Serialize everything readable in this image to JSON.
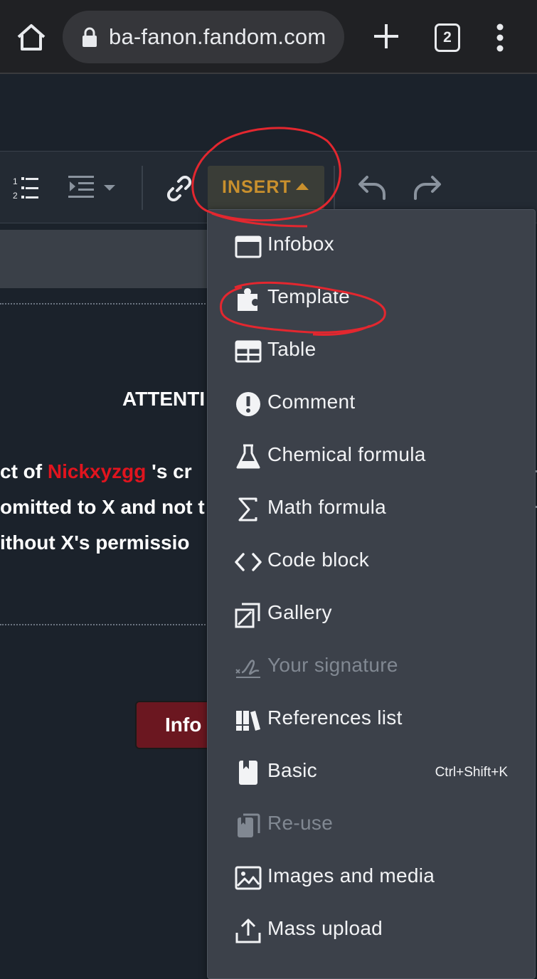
{
  "browser": {
    "url": "ba-fanon.fandom.com",
    "tab_count": "2",
    "icons": [
      "home-icon",
      "lock-icon",
      "plus-icon",
      "tab-switcher-icon",
      "overflow-menu-icon"
    ]
  },
  "toolbar": {
    "insert_label": "INSERT",
    "icons": [
      "numbered-list-icon",
      "indent-icon",
      "link-icon",
      "undo-icon",
      "redo-icon"
    ]
  },
  "content": {
    "heading": "ATTENTI",
    "line1_before": "ct of ",
    "line1_user": "Nickxyzgg",
    "line1_after": " 's cr",
    "line2": "omitted to X and not t",
    "line3": "ithout X's permissio",
    "info_button": "Info"
  },
  "insert_menu": {
    "items": [
      {
        "label": "Infobox",
        "icon": "infobox-icon",
        "disabled": false,
        "shortcut": ""
      },
      {
        "label": "Template",
        "icon": "puzzle-piece-icon",
        "disabled": false,
        "shortcut": ""
      },
      {
        "label": "Table",
        "icon": "table-icon",
        "disabled": false,
        "shortcut": ""
      },
      {
        "label": "Comment",
        "icon": "exclamation-circle-icon",
        "disabled": false,
        "shortcut": ""
      },
      {
        "label": "Chemical formula",
        "icon": "flask-icon",
        "disabled": false,
        "shortcut": ""
      },
      {
        "label": "Math formula",
        "icon": "sigma-icon",
        "disabled": false,
        "shortcut": ""
      },
      {
        "label": "Code block",
        "icon": "code-icon",
        "disabled": false,
        "shortcut": ""
      },
      {
        "label": "Gallery",
        "icon": "gallery-icon",
        "disabled": false,
        "shortcut": ""
      },
      {
        "label": "Your signature",
        "icon": "signature-icon",
        "disabled": true,
        "shortcut": ""
      },
      {
        "label": "References list",
        "icon": "references-icon",
        "disabled": false,
        "shortcut": ""
      },
      {
        "label": "Basic",
        "icon": "bookmark-icon",
        "disabled": false,
        "shortcut": "Ctrl+Shift+K"
      },
      {
        "label": "Re-use",
        "icon": "reuse-icon",
        "disabled": true,
        "shortcut": ""
      },
      {
        "label": "Images and media",
        "icon": "image-icon",
        "disabled": false,
        "shortcut": ""
      },
      {
        "label": "Mass upload",
        "icon": "upload-icon",
        "disabled": false,
        "shortcut": ""
      }
    ]
  },
  "colors": {
    "accent_insert": "#c9902d",
    "annotation_red": "#e3272f",
    "username_red": "#e1141e",
    "menu_bg": "#3c414a"
  }
}
